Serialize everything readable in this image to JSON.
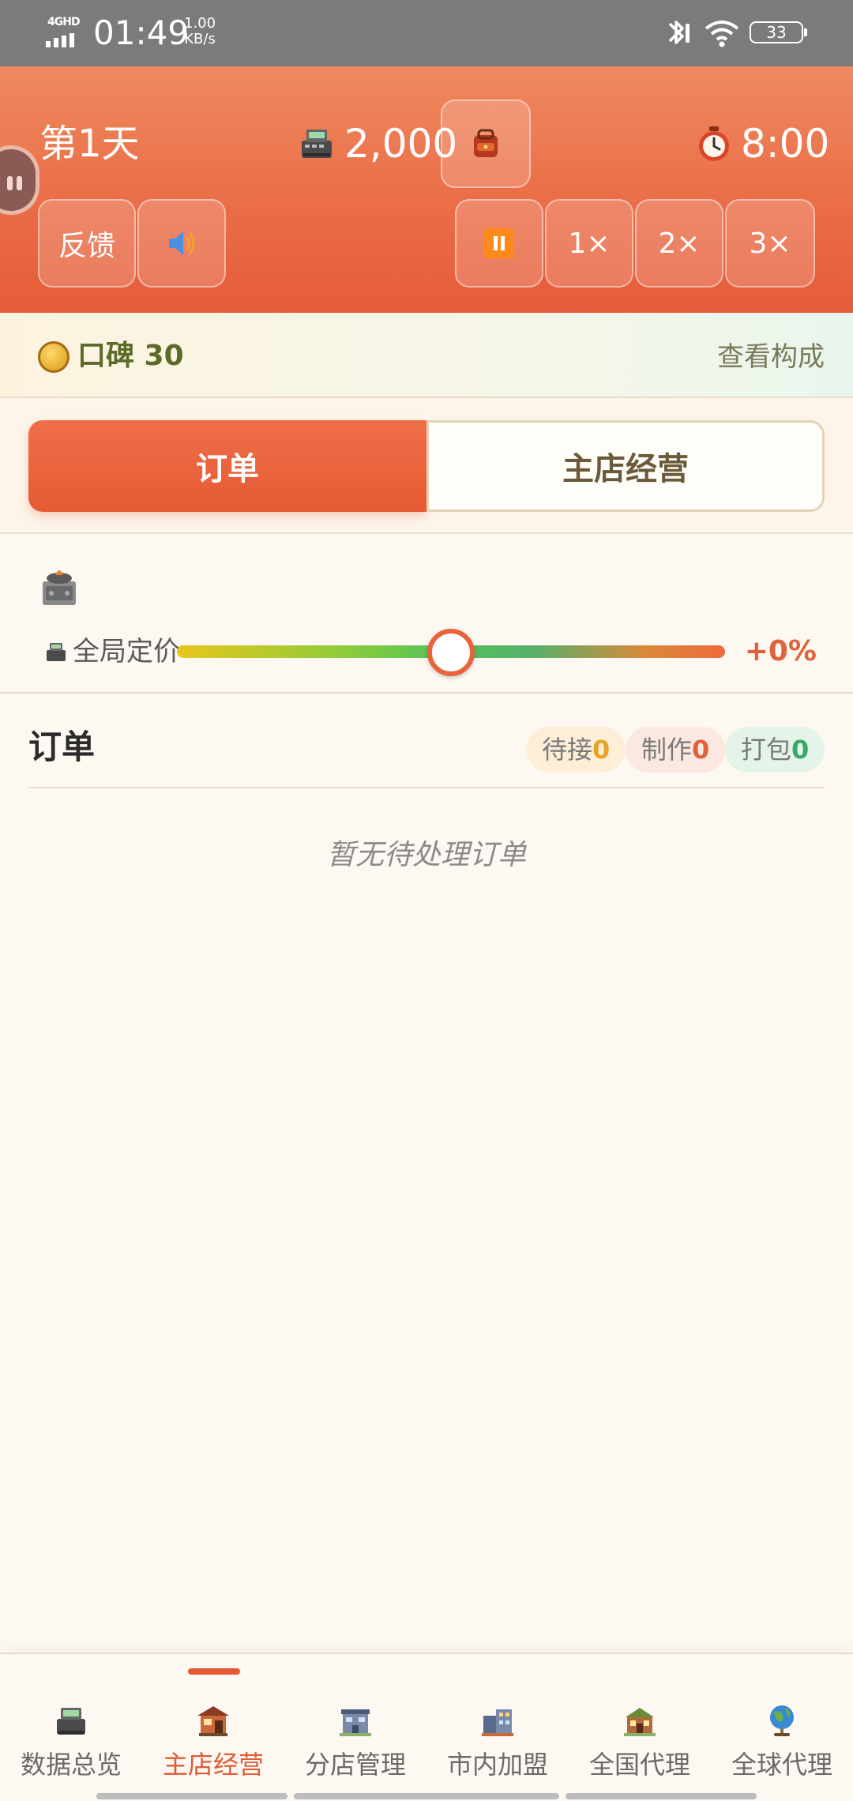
{
  "status_bar": {
    "network": "4GHD",
    "time": "01:49",
    "speed_value": "1.00",
    "speed_unit": "KB/s",
    "battery": "33"
  },
  "header": {
    "day": "第1天",
    "money": "2,000",
    "timer": "8:00",
    "feedback_label": "反馈",
    "speed_1": "1×",
    "speed_2": "2×",
    "speed_3": "3×"
  },
  "reputation": {
    "label": "口碑 30",
    "link": "查看构成"
  },
  "tabs": [
    {
      "label": "订单",
      "active": true
    },
    {
      "label": "主店经营",
      "active": false
    }
  ],
  "pricing": {
    "label": "全局定价",
    "value": "+0%",
    "slider_fraction": 0.5
  },
  "orders": {
    "title": "订单",
    "badges": [
      {
        "label": "待接",
        "count": "0"
      },
      {
        "label": "制作",
        "count": "0"
      },
      {
        "label": "打包",
        "count": "0"
      }
    ],
    "empty_text": "暂无待处理订单"
  },
  "bottom_nav": [
    {
      "label": "数据总览",
      "icon": "cash-register-icon",
      "active": false
    },
    {
      "label": "主店经营",
      "icon": "shop-icon",
      "active": true
    },
    {
      "label": "分店管理",
      "icon": "branch-building-icon",
      "active": false
    },
    {
      "label": "市内加盟",
      "icon": "city-building-icon",
      "active": false
    },
    {
      "label": "全国代理",
      "icon": "country-building-icon",
      "active": false
    },
    {
      "label": "全球代理",
      "icon": "globe-icon",
      "active": false
    }
  ],
  "colors": {
    "accent": "#e55a35",
    "header_top": "#ef8960",
    "background": "#fdf8f1"
  }
}
